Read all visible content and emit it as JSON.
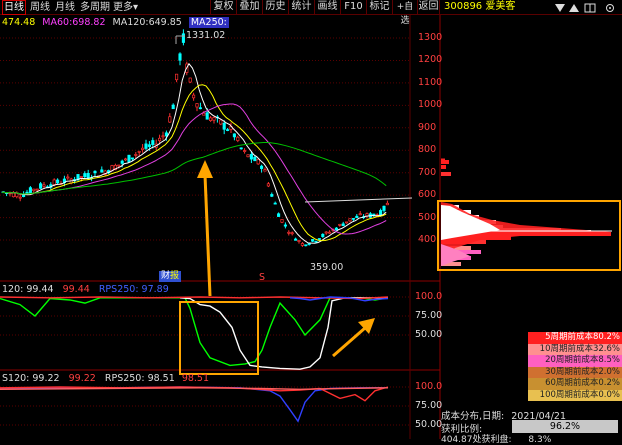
{
  "toolbar": {
    "tabs": [
      {
        "label": "日线",
        "active": true
      },
      {
        "label": "周线",
        "active": false
      },
      {
        "label": "月线",
        "active": false
      },
      {
        "label": "多周期",
        "active": false
      },
      {
        "label": "更多",
        "active": false
      }
    ],
    "more_arrow": "▾",
    "buttons": [
      "复权",
      "叠加",
      "历史",
      "统计",
      "画线",
      "F10",
      "标记"
    ],
    "add_watch": "+自选",
    "back": "返回",
    "stock_code": "300896",
    "stock_name": "爱美客",
    "icons": [
      "down-arrow-icon",
      "up-arrow-icon",
      "grid-icon",
      "settings-icon"
    ]
  },
  "ma_legend": {
    "ma_trunc": "474.48",
    "ma60_label": "MA60:",
    "ma60": "698.82",
    "ma120_label": "MA120:",
    "ma120": "649.85",
    "ma250_label": "MA250:"
  },
  "price_axis": [
    "1300",
    "1200",
    "1100",
    "1000",
    "900",
    "800",
    "700",
    "600",
    "500",
    "400"
  ],
  "annotations": {
    "high": "1331.02",
    "low": "359.00",
    "marker_cai": "财",
    "marker_bao": "报",
    "marker_s": "S"
  },
  "rps_panel1": {
    "label1": "120: 99.44",
    "label2": "99.44",
    "label3": "RPS250: 97.89",
    "label4": "97.89",
    "axis": [
      "100.0",
      "75.00",
      "50.00"
    ]
  },
  "rps_panel2": {
    "label1": "S120: 99.22",
    "label2": "99.22",
    "label3": "RPS250: 98.51",
    "label4": "98.51",
    "axis": [
      "100.0",
      "75.00",
      "50.00"
    ]
  },
  "cost_distribution": {
    "rows": [
      {
        "label": "5周期前成本80.2%",
        "color": "#ff2020"
      },
      {
        "label": "10周期前成本32.6%",
        "color": "#ff9090"
      },
      {
        "label": "20周期前成本8.5%",
        "color": "#ff60c0"
      },
      {
        "label": "30周期前成本2.0%",
        "color": "#d07030"
      },
      {
        "label": "60周期前成本0.2%",
        "color": "#c89030"
      },
      {
        "label": "100周期前成本0.0%",
        "color": "#e8c050"
      }
    ],
    "date_label": "成本分布,日期:",
    "date": "2021/04/21",
    "profit_label": "获利比例:",
    "profit_value": "96.2%",
    "avg_label": "404.87处获利盘:",
    "avg_value": "8.3%"
  },
  "colors": {
    "up": "#ff3030",
    "down": "#00ffff",
    "ma5": "#ffffff",
    "ma10": "#ffff00",
    "ma20": "#e040e0",
    "ma60": "#00c000",
    "accent_box": "#ffa500",
    "grid_red": "#6a0000"
  }
}
